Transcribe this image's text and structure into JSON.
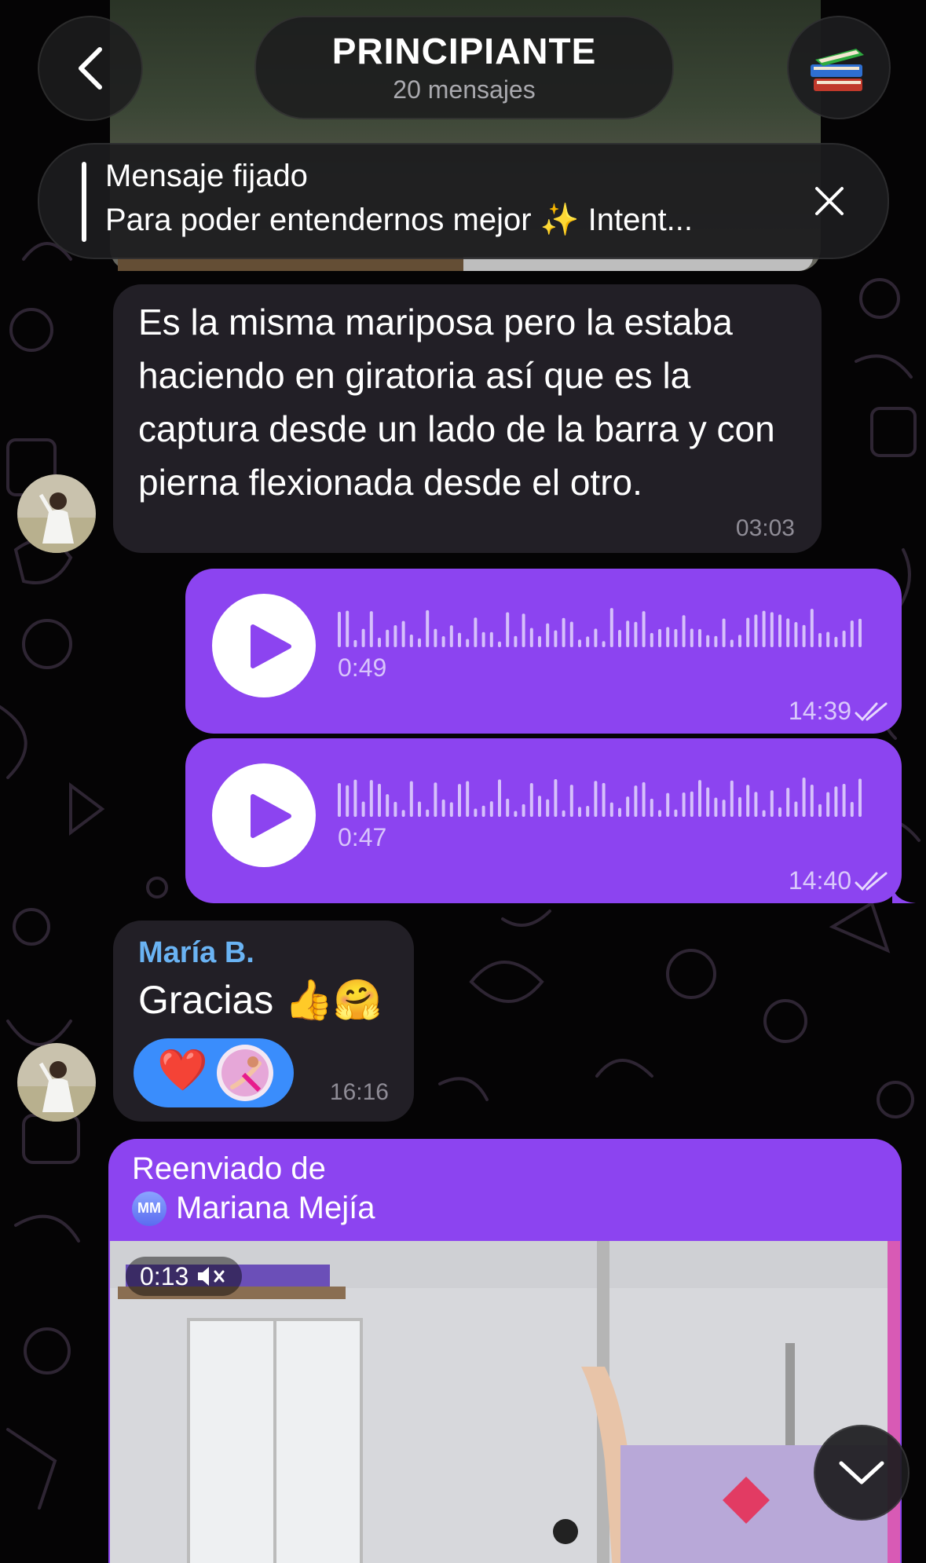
{
  "header": {
    "title": "PRINCIPIANTE",
    "subtitle": "20 mensajes",
    "back_icon": "chevron-left-icon",
    "group_avatar_icon": "books-icon"
  },
  "pinned": {
    "label": "Mensaje fijado",
    "preview": "Para poder entendernos mejor ✨ Intent..."
  },
  "messages": {
    "text_in": {
      "text": "Es la misma mariposa pero la estaba haciendo en giratoria así que es la captura desde un lado de la barra y con pierna flexionada desde el otro.",
      "time": "03:03"
    },
    "voice1": {
      "duration": "0:49",
      "time": "14:39"
    },
    "voice2": {
      "duration": "0:47",
      "time": "14:40"
    },
    "reply_in": {
      "sender": "María B.",
      "text": "Gracias 👍🤗",
      "reaction": "❤️",
      "time": "16:16"
    },
    "forwarded": {
      "label": "Reenviado de",
      "initials": "MM",
      "from": "Mariana Mejía",
      "video_duration": "0:13",
      "mute_icon": "speaker-muted-icon"
    }
  },
  "colors": {
    "outgoing_bubble": "#8c44f0",
    "incoming_bubble": "#221f26",
    "sender_name": "#6ab3f3",
    "reaction_pill": "#3a8dfc"
  }
}
